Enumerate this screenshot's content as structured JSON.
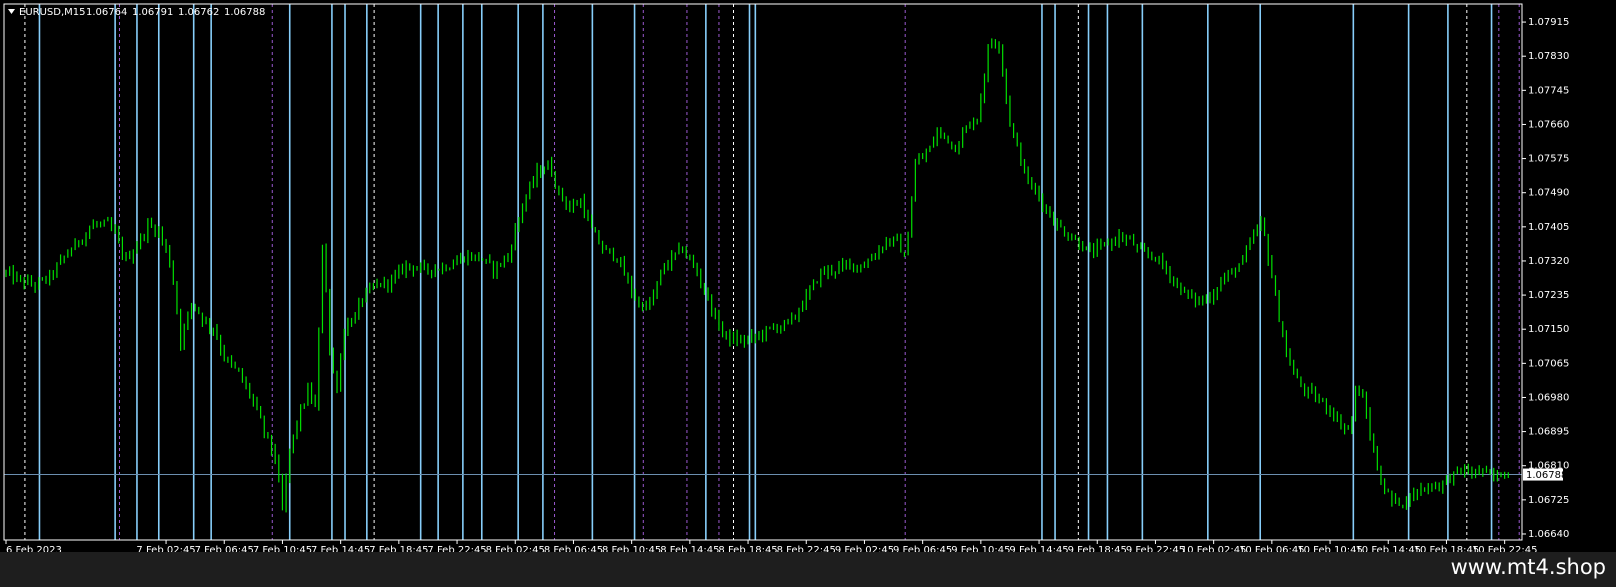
{
  "header": {
    "symbol_label": "EURUSD,M15",
    "ohlc": [
      "1.06764",
      "1.06791",
      "1.06762",
      "1.06788"
    ]
  },
  "watermark": "www.mt4.shop",
  "colors": {
    "background": "#000000",
    "frame": "#ffffff",
    "candle": "#00e000",
    "solid_line": "#87cefa",
    "dashed_white": "#ffffff",
    "dashed_violet": "#9b59d0",
    "price_line": "#6c8fb0",
    "text": "#ffffff"
  },
  "chart_data": {
    "type": "line",
    "subtype": "candlestick",
    "symbol": "EURUSD",
    "timeframe": "M15",
    "series_color": "#00e000",
    "ylim": [
      1.06625,
      1.0796
    ],
    "y_ticks": [
      "1.07915",
      "1.07830",
      "1.07745",
      "1.07660",
      "1.07575",
      "1.07490",
      "1.07405",
      "1.07320",
      "1.07235",
      "1.07150",
      "1.07065",
      "1.06980",
      "1.06895",
      "1.06810",
      "1.06725",
      "1.06640"
    ],
    "x_ticks": [
      "6 Feb 2023",
      "7 Feb 02:45",
      "7 Feb 06:45",
      "7 Feb 10:45",
      "7 Feb 14:45",
      "7 Feb 18:45",
      "7 Feb 22:45",
      "8 Feb 02:45",
      "8 Feb 06:45",
      "8 Feb 10:45",
      "8 Feb 14:45",
      "8 Feb 18:45",
      "8 Feb 22:45",
      "9 Feb 02:45",
      "9 Feb 06:45",
      "9 Feb 10:45",
      "9 Feb 14:45",
      "9 Feb 18:45",
      "9 Feb 22:45",
      "10 Feb 02:45",
      "10 Feb 06:45",
      "10 Feb 10:45",
      "10 Feb 14:45",
      "10 Feb 18:45",
      "10 Feb 22:45"
    ],
    "x_tick_units": [
      0,
      11,
      15,
      19,
      23,
      27,
      31,
      35,
      39,
      43,
      47,
      51,
      55,
      59,
      63,
      67,
      71,
      75,
      79,
      83,
      87,
      91,
      95,
      99,
      103
    ],
    "x_range_units": [
      0,
      104.3
    ],
    "current_price": "1.06788",
    "current_price_value": 1.06788,
    "solid_vlines_units": [
      2.3,
      7.5,
      9.0,
      10.5,
      12.9,
      14.1,
      19.5,
      22.4,
      23.3,
      24.8,
      28.5,
      29.7,
      31.4,
      32.7,
      35.2,
      36.9,
      40.3,
      43.2,
      48.1,
      51.1,
      51.5,
      71.2,
      72.1,
      74.4,
      75.7,
      78.1,
      82.6,
      86.2,
      92.6,
      96.4,
      99.1,
      102.1
    ],
    "dashed_white_vlines_units": [
      1.3,
      25.3,
      50.0,
      73.7,
      100.4
    ],
    "dashed_violet_vlines_units": [
      7.8,
      18.3,
      37.7,
      43.8,
      46.8,
      49.0,
      61.8,
      102.6,
      104.0
    ],
    "price_path_anchors": [
      [
        0,
        1.0729
      ],
      [
        1.0,
        1.0727
      ],
      [
        2.0,
        1.0726
      ],
      [
        3.0,
        1.0728
      ],
      [
        4.0,
        1.0733
      ],
      [
        5.0,
        1.0737
      ],
      [
        6.0,
        1.0741
      ],
      [
        7.0,
        1.0741
      ],
      [
        7.6,
        1.0738
      ],
      [
        8.2,
        1.0732
      ],
      [
        9.0,
        1.0736
      ],
      [
        9.8,
        1.0741
      ],
      [
        10.6,
        1.0739
      ],
      [
        11.4,
        1.073
      ],
      [
        12.0,
        1.0712
      ],
      [
        12.8,
        1.0722
      ],
      [
        13.6,
        1.0717
      ],
      [
        14.3,
        1.0715
      ],
      [
        15.0,
        1.0708
      ],
      [
        16.0,
        1.0704
      ],
      [
        17.0,
        1.0697
      ],
      [
        17.7,
        1.069
      ],
      [
        18.5,
        1.0683
      ],
      [
        19.0,
        1.067
      ],
      [
        19.5,
        1.0685
      ],
      [
        20.2,
        1.0694
      ],
      [
        20.8,
        1.07
      ],
      [
        21.3,
        1.0695
      ],
      [
        21.8,
        1.0741
      ],
      [
        22.2,
        1.071
      ],
      [
        22.7,
        1.07
      ],
      [
        23.3,
        1.0716
      ],
      [
        24.0,
        1.0718
      ],
      [
        24.5,
        1.0723
      ],
      [
        25.5,
        1.0726
      ],
      [
        26.5,
        1.0727
      ],
      [
        27.5,
        1.0731
      ],
      [
        28.5,
        1.073
      ],
      [
        29.5,
        1.073
      ],
      [
        30.5,
        1.0731
      ],
      [
        31.5,
        1.0733
      ],
      [
        32.5,
        1.0733
      ],
      [
        33.5,
        1.073
      ],
      [
        34.5,
        1.0733
      ],
      [
        35.5,
        1.0746
      ],
      [
        36.5,
        1.0754
      ],
      [
        37.3,
        1.0756
      ],
      [
        38.0,
        1.0749
      ],
      [
        38.8,
        1.0745
      ],
      [
        39.5,
        1.0747
      ],
      [
        40.2,
        1.074
      ],
      [
        41.0,
        1.0735
      ],
      [
        42.0,
        1.0733
      ],
      [
        42.8,
        1.0726
      ],
      [
        43.5,
        1.0721
      ],
      [
        44.3,
        1.0721
      ],
      [
        45.0,
        1.0729
      ],
      [
        45.8,
        1.0733
      ],
      [
        46.5,
        1.0735
      ],
      [
        47.2,
        1.0731
      ],
      [
        48.0,
        1.0725
      ],
      [
        48.7,
        1.0718
      ],
      [
        49.5,
        1.0713
      ],
      [
        50.5,
        1.0712
      ],
      [
        51.5,
        1.0713
      ],
      [
        52.5,
        1.0715
      ],
      [
        53.3,
        1.0716
      ],
      [
        54.0,
        1.0717
      ],
      [
        55.0,
        1.0723
      ],
      [
        56.0,
        1.0729
      ],
      [
        57.0,
        1.073
      ],
      [
        58.0,
        1.0731
      ],
      [
        59.0,
        1.0731
      ],
      [
        59.8,
        1.0734
      ],
      [
        60.5,
        1.0737
      ],
      [
        61.3,
        1.0737
      ],
      [
        61.8,
        1.0732
      ],
      [
        62.5,
        1.0756
      ],
      [
        63.5,
        1.076
      ],
      [
        64.0,
        1.0764
      ],
      [
        64.6,
        1.0763
      ],
      [
        65.2,
        1.076
      ],
      [
        66.0,
        1.0765
      ],
      [
        66.8,
        1.0768
      ],
      [
        67.6,
        1.0787
      ],
      [
        68.3,
        1.0786
      ],
      [
        68.9,
        1.0768
      ],
      [
        69.5,
        1.076
      ],
      [
        70.2,
        1.0752
      ],
      [
        71.0,
        1.0748
      ],
      [
        72.0,
        1.0742
      ],
      [
        72.8,
        1.0739
      ],
      [
        73.6,
        1.0737
      ],
      [
        74.5,
        1.0734
      ],
      [
        75.5,
        1.0736
      ],
      [
        76.5,
        1.0738
      ],
      [
        77.3,
        1.0737
      ],
      [
        78.0,
        1.0734
      ],
      [
        79.0,
        1.0733
      ],
      [
        79.7,
        1.073
      ],
      [
        80.5,
        1.0726
      ],
      [
        81.3,
        1.0723
      ],
      [
        82.0,
        1.0722
      ],
      [
        82.8,
        1.0723
      ],
      [
        83.5,
        1.0727
      ],
      [
        84.2,
        1.0729
      ],
      [
        85.0,
        1.0732
      ],
      [
        85.7,
        1.0738
      ],
      [
        86.3,
        1.0742
      ],
      [
        86.9,
        1.073
      ],
      [
        87.5,
        1.0718
      ],
      [
        88.0,
        1.0709
      ],
      [
        88.6,
        1.0703
      ],
      [
        89.2,
        1.07
      ],
      [
        90.0,
        1.0698
      ],
      [
        91.0,
        1.0695
      ],
      [
        91.8,
        1.0691
      ],
      [
        92.4,
        1.069
      ],
      [
        92.8,
        1.0701
      ],
      [
        93.4,
        1.0696
      ],
      [
        94.0,
        1.0684
      ],
      [
        94.6,
        1.0676
      ],
      [
        95.3,
        1.0672
      ],
      [
        96.0,
        1.0672
      ],
      [
        96.8,
        1.0674
      ],
      [
        97.6,
        1.0676
      ],
      [
        98.4,
        1.0676
      ],
      [
        99.2,
        1.0678
      ],
      [
        100.0,
        1.068
      ],
      [
        100.7,
        1.0679
      ],
      [
        101.4,
        1.068
      ],
      [
        102.1,
        1.0678
      ],
      [
        102.8,
        1.0679
      ],
      [
        103.4,
        1.0679
      ]
    ]
  }
}
